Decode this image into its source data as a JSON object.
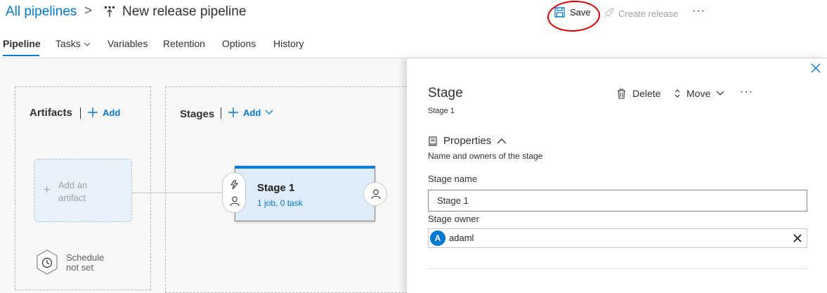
{
  "breadcrumb": {
    "root": "All pipelines",
    "separator": ">",
    "title": "New release pipeline"
  },
  "toolbar": {
    "save": "Save",
    "create_release": "Create release",
    "more": "···"
  },
  "tabs": [
    {
      "label": "Pipeline",
      "active": true
    },
    {
      "label": "Tasks",
      "has_dropdown": true
    },
    {
      "label": "Variables"
    },
    {
      "label": "Retention"
    },
    {
      "label": "Options"
    },
    {
      "label": "History"
    }
  ],
  "artifacts": {
    "title": "Artifacts",
    "add_label": "Add",
    "card_line1": "Add an",
    "card_line2": "artifact",
    "schedule_line1": "Schedule",
    "schedule_line2": "not set"
  },
  "stages": {
    "title": "Stages",
    "add_label": "Add",
    "card": {
      "name": "Stage 1",
      "sub": "1 job, 0 task"
    }
  },
  "panel": {
    "title": "Stage",
    "subtitle": "Stage 1",
    "delete": "Delete",
    "move": "Move",
    "more": "···",
    "section": "Properties",
    "section_desc": "Name and owners of the stage",
    "name_label": "Stage name",
    "name_value": "Stage 1",
    "owner_label": "Stage owner",
    "owner_initial": "A",
    "owner_name": "adaml"
  },
  "colors": {
    "accent": "#0078d4",
    "annotation_circle": "#e00000"
  }
}
